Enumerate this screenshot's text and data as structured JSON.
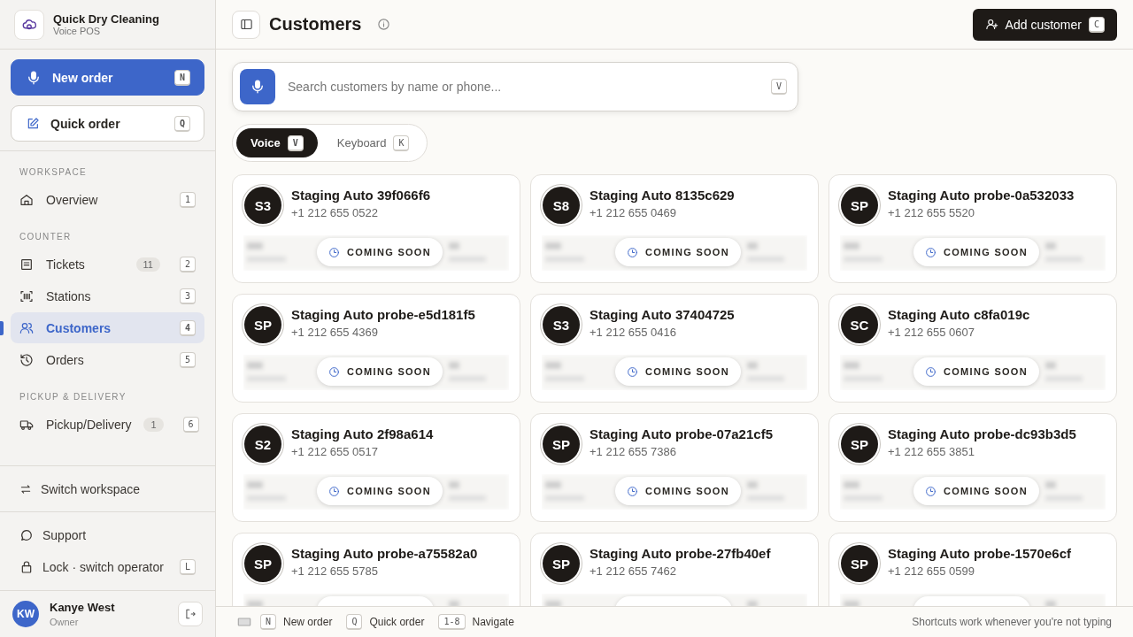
{
  "brand": {
    "name": "Quick Dry Cleaning",
    "subtitle": "Voice POS"
  },
  "actions": [
    {
      "kind": "primary",
      "label": "New order",
      "shortcut": "N"
    },
    {
      "kind": "secondary",
      "label": "Quick order",
      "shortcut": "Q"
    }
  ],
  "nav": [
    {
      "title": "WORKSPACE",
      "items": [
        {
          "label": "Overview",
          "shortcut": "1",
          "selected": false
        }
      ]
    },
    {
      "title": "COUNTER",
      "items": [
        {
          "label": "Tickets",
          "count": "11",
          "shortcut": "2",
          "selected": false
        },
        {
          "label": "Stations",
          "shortcut": "3",
          "selected": false
        },
        {
          "label": "Customers",
          "shortcut": "4",
          "selected": true
        },
        {
          "label": "Orders",
          "shortcut": "5",
          "selected": false
        }
      ]
    },
    {
      "title": "PICKUP & DELIVERY",
      "items": [
        {
          "label": "Pickup/Delivery",
          "count": "1",
          "shortcut": "6",
          "selected": false
        }
      ]
    }
  ],
  "switch_workspace": "Switch workspace",
  "support": "Support",
  "lock": {
    "label": "Lock · switch operator",
    "shortcut": "L"
  },
  "user": {
    "initials": "KW",
    "name": "Kanye West",
    "role": "Owner"
  },
  "header": {
    "title": "Customers",
    "add_button": {
      "label": "Add customer",
      "shortcut": "C"
    }
  },
  "search": {
    "placeholder": "Search customers by name or phone...",
    "shortcut": "V"
  },
  "modes": [
    {
      "label": "Voice",
      "shortcut": "V",
      "selected": true
    },
    {
      "label": "Keyboard",
      "shortcut": "K",
      "selected": false
    }
  ],
  "customers": [
    {
      "initials": "S3",
      "name": "Staging Auto 39f066f6",
      "phone": "+1 212 655 0522",
      "badge": "COMING SOON"
    },
    {
      "initials": "S8",
      "name": "Staging Auto 8135c629",
      "phone": "+1 212 655 0469",
      "badge": "COMING SOON"
    },
    {
      "initials": "SP",
      "name": "Staging Auto probe-0a532033",
      "phone": "+1 212 655 5520",
      "badge": "COMING SOON"
    },
    {
      "initials": "SP",
      "name": "Staging Auto probe-e5d181f5",
      "phone": "+1 212 655 4369",
      "badge": "COMING SOON"
    },
    {
      "initials": "S3",
      "name": "Staging Auto 37404725",
      "phone": "+1 212 655 0416",
      "badge": "COMING SOON"
    },
    {
      "initials": "SC",
      "name": "Staging Auto c8fa019c",
      "phone": "+1 212 655 0607",
      "badge": "COMING SOON"
    },
    {
      "initials": "S2",
      "name": "Staging Auto 2f98a614",
      "phone": "+1 212 655 0517",
      "badge": "COMING SOON"
    },
    {
      "initials": "SP",
      "name": "Staging Auto probe-07a21cf5",
      "phone": "+1 212 655 7386",
      "badge": "COMING SOON"
    },
    {
      "initials": "SP",
      "name": "Staging Auto probe-dc93b3d5",
      "phone": "+1 212 655 3851",
      "badge": "COMING SOON"
    },
    {
      "initials": "SP",
      "name": "Staging Auto probe-a75582a0",
      "phone": "+1 212 655 5785"
    },
    {
      "initials": "SP",
      "name": "Staging Auto probe-27fb40ef",
      "phone": "+1 212 655 7462"
    },
    {
      "initials": "SP",
      "name": "Staging Auto probe-1570e6cf",
      "phone": "+1 212 655 0599"
    }
  ],
  "footer": {
    "shortcuts": [
      {
        "key": "N",
        "label": "New order"
      },
      {
        "key": "Q",
        "label": "Quick order"
      },
      {
        "key": "1-8",
        "label": "Navigate"
      }
    ],
    "hint": "Shortcuts work whenever you're not typing"
  }
}
